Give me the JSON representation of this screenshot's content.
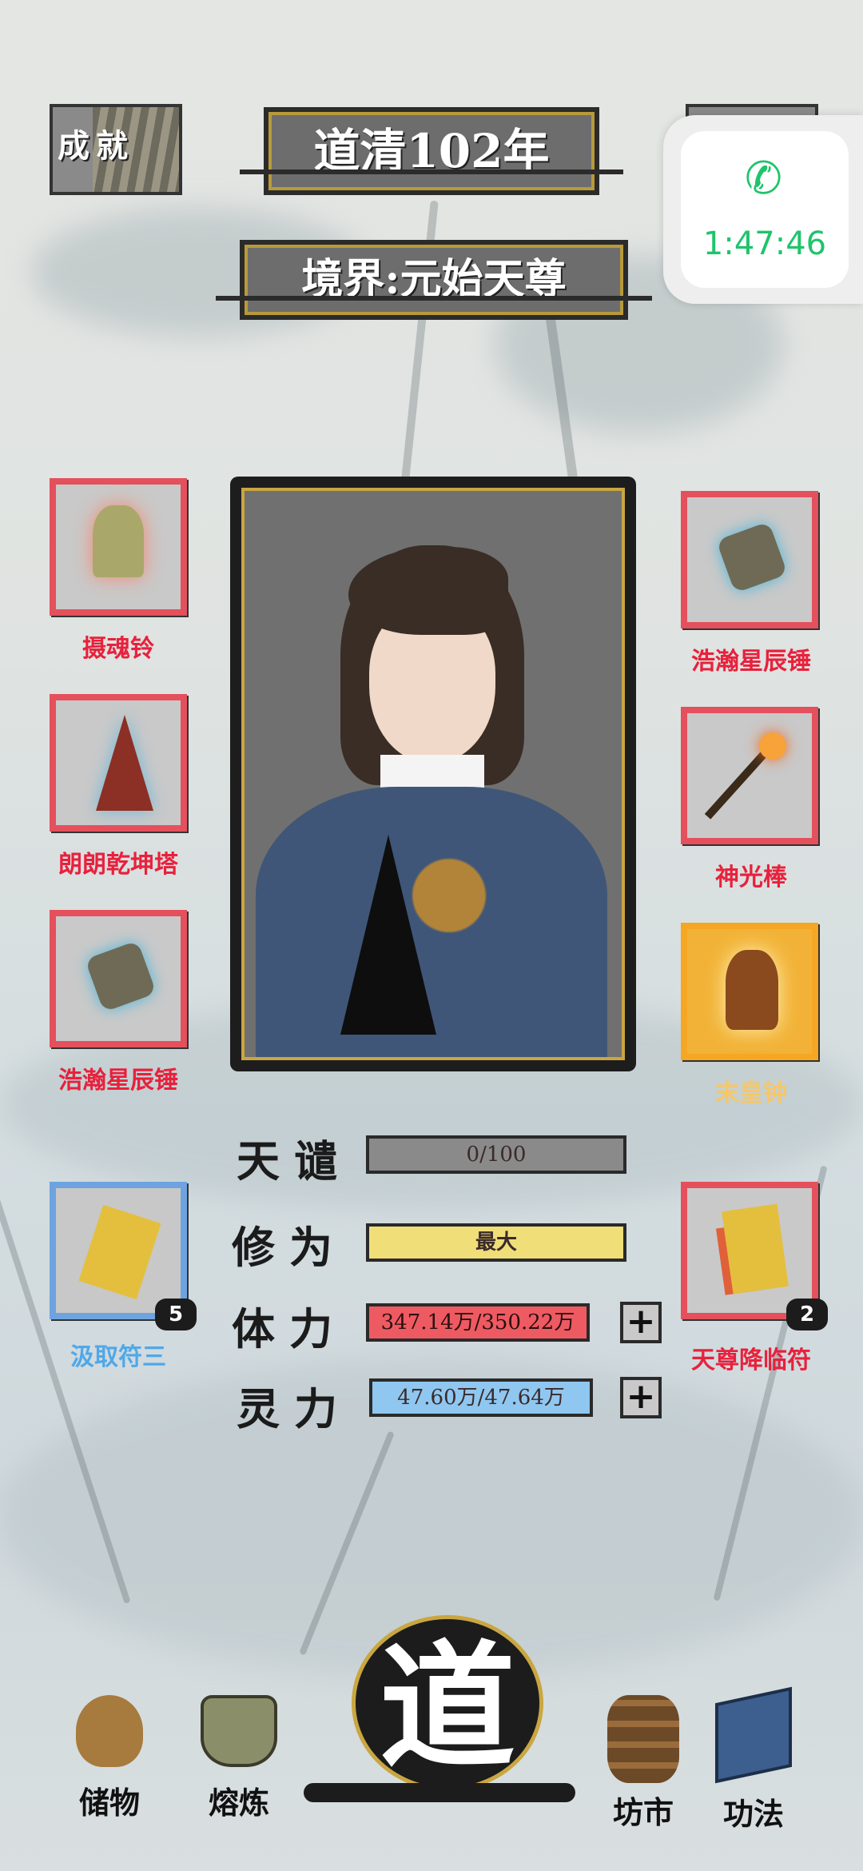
{
  "header": {
    "achievement_label": "成就",
    "year_title": "道清102年",
    "realm_title": "境界:元始天尊"
  },
  "call_widget": {
    "timer": "1:47:46",
    "accent": "#1ec46b"
  },
  "equipment": {
    "left": [
      {
        "name": "摄魂铃",
        "icon": "bell-icon"
      },
      {
        "name": "朗朗乾坤塔",
        "icon": "pagoda-icon"
      },
      {
        "name": "浩瀚星辰锤",
        "icon": "hammer-icon"
      }
    ],
    "right": [
      {
        "name": "浩瀚星辰锤",
        "icon": "hammer-icon"
      },
      {
        "name": "神光棒",
        "icon": "staff-icon"
      },
      {
        "name": "末皇钟",
        "icon": "golden-bell-icon"
      }
    ]
  },
  "talismans": {
    "left": {
      "name": "汲取符三",
      "count": "5",
      "icon": "talisman-icon"
    },
    "right": {
      "name": "天尊降临符",
      "count": "2",
      "icon": "talisman-ribbon-icon"
    }
  },
  "stats": {
    "tribulation": {
      "label": "天谴",
      "value": "0/100",
      "fill": 0.0
    },
    "cultivation": {
      "label": "修为",
      "value": "最大",
      "fill": 1.0
    },
    "stamina": {
      "label": "体力",
      "value": "347.14万/350.22万",
      "fill": 0.99
    },
    "spirit": {
      "label": "灵力",
      "value": "47.60万/47.64万",
      "fill": 0.999
    }
  },
  "bottom_nav": {
    "storage": "储物",
    "smelt": "熔炼",
    "dao": "道",
    "market": "坊市",
    "skills": "功法"
  }
}
